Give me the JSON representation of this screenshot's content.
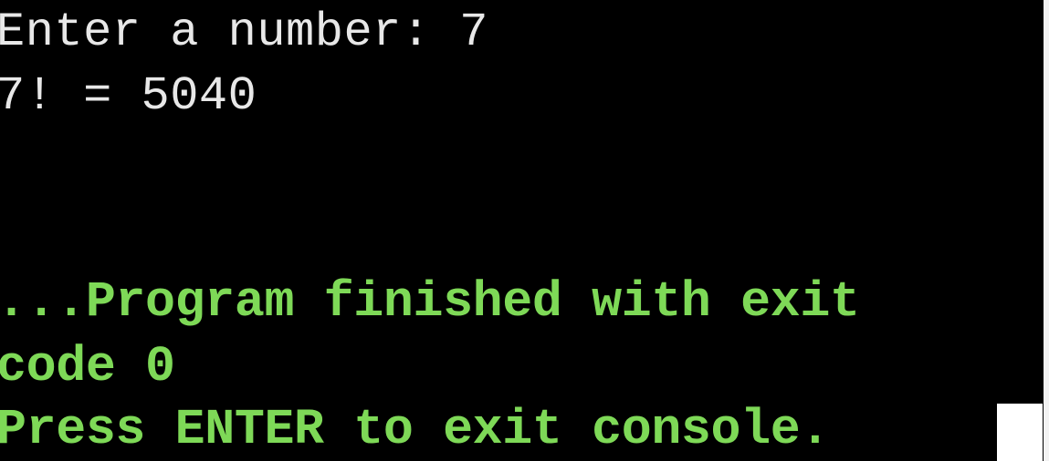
{
  "console": {
    "lines": [
      "Enter a number: 7",
      "7! = 5040",
      "...Program finished with exit",
      "code 0",
      "Press ENTER to exit console."
    ]
  },
  "colors": {
    "background": "#000000",
    "program_output": "#e8e8e8",
    "system_message": "#7ed957",
    "cursor": "#ffffff"
  }
}
